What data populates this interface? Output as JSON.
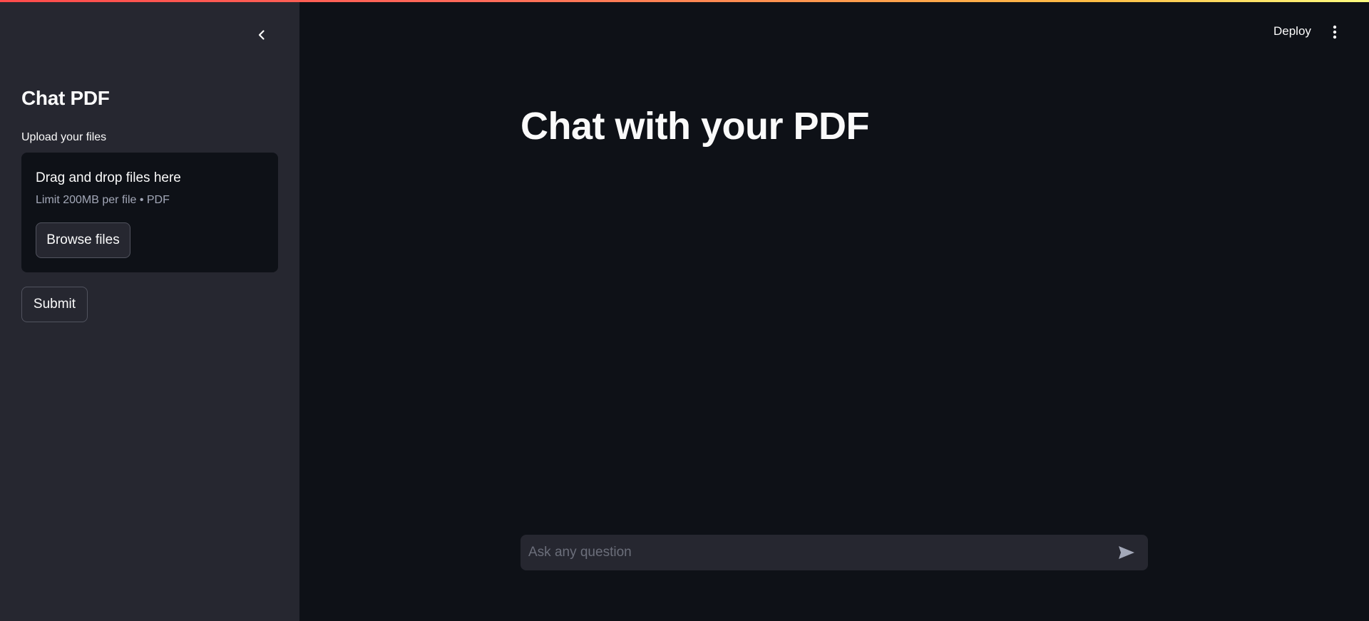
{
  "header": {
    "deploy_label": "Deploy"
  },
  "sidebar": {
    "title": "Chat PDF",
    "upload_label": "Upload your files",
    "dropzone": {
      "title": "Drag and drop files here",
      "limit": "Limit 200MB per file • PDF",
      "browse_label": "Browse files"
    },
    "submit_label": "Submit"
  },
  "main": {
    "title": "Chat with your PDF",
    "chat_input": {
      "placeholder": "Ask any question",
      "value": ""
    }
  },
  "icons": {
    "collapse": "chevron-left-icon",
    "menu": "kebab-menu-icon",
    "send": "send-icon"
  },
  "colors": {
    "background": "#0e1117",
    "sidebar": "#262730",
    "text": "#fafafa",
    "muted_text": "#a3a8b8",
    "accent_gradient_start": "#ff4b4b",
    "accent_gradient_end": "#fffd80"
  }
}
